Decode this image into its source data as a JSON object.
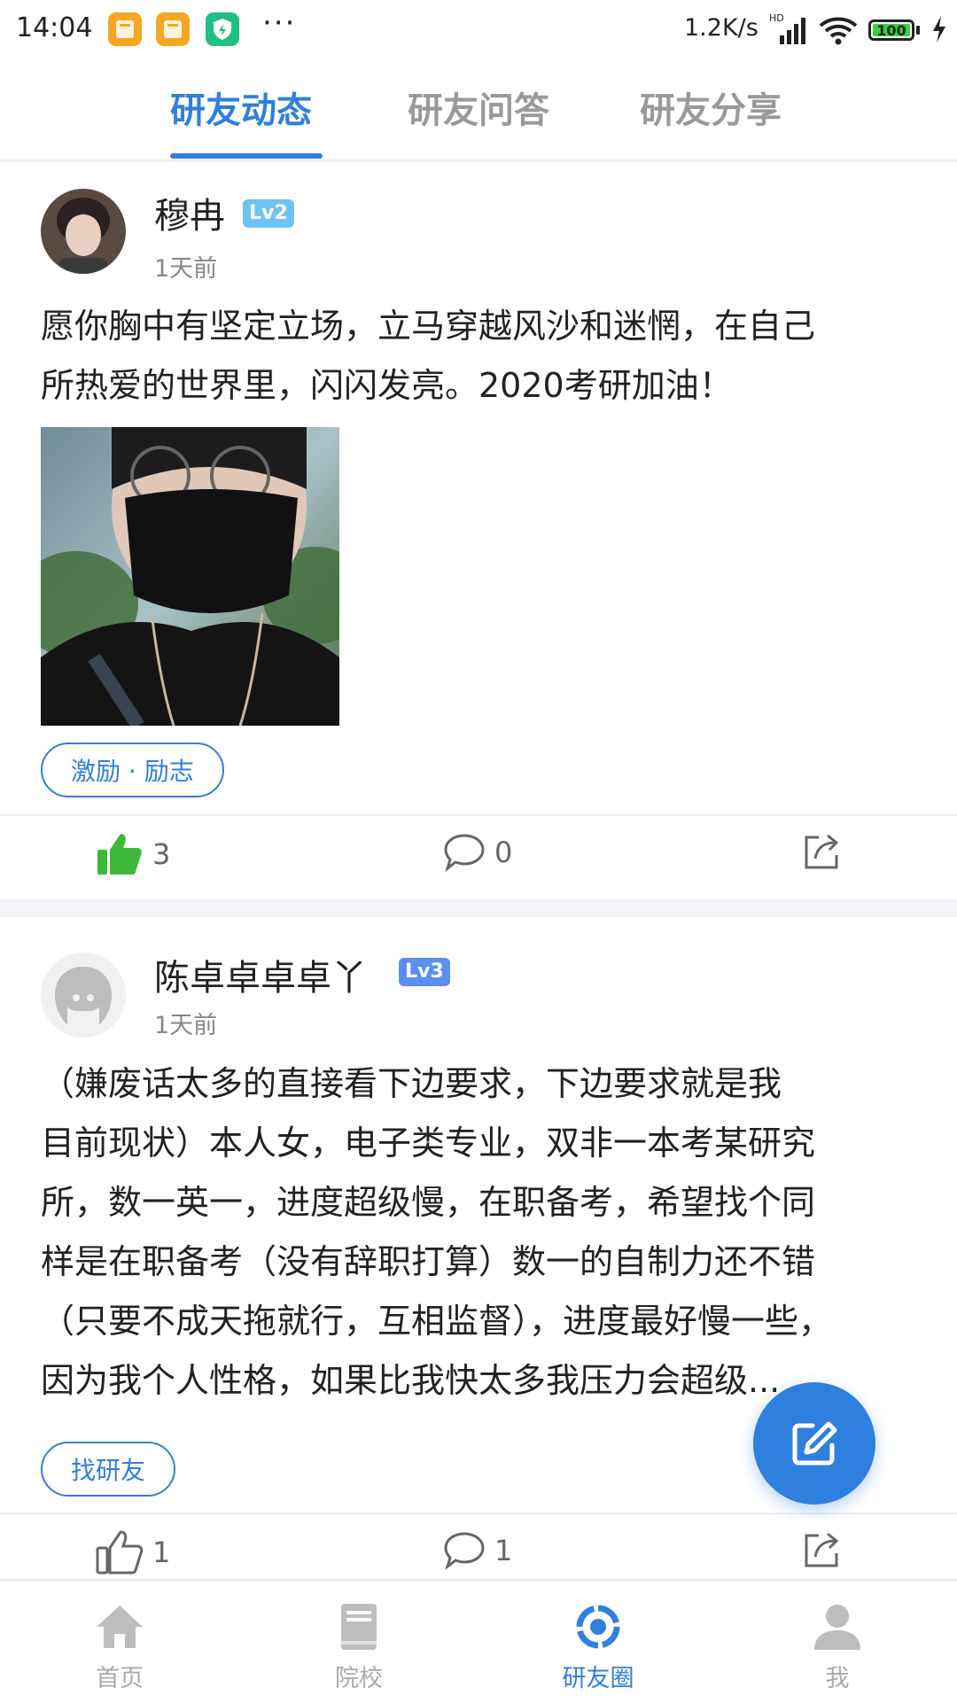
{
  "status_bar": {
    "time": "14:04",
    "network_speed": "1.2K/s",
    "network_type": "HD",
    "battery": "100",
    "notification_icons": [
      "orange-app-icon",
      "orange-app-icon",
      "green-shield-icon"
    ],
    "more": "···"
  },
  "tabs": [
    {
      "label": "研友动态",
      "active": true
    },
    {
      "label": "研友问答",
      "active": false
    },
    {
      "label": "研友分享",
      "active": false
    }
  ],
  "posts": [
    {
      "username": "穆冉",
      "level": "Lv2",
      "level_color": "#6ec3f2",
      "time": "1天前",
      "content_line1": "愿你胸中有坚定立场，立马穿越风沙和迷惘，在自己",
      "content_line2": "所热爱的世界里，闪闪发亮。2020考研加油！",
      "has_image": true,
      "tag": "激励 · 励志",
      "likes": "3",
      "liked": true,
      "comments": "0"
    },
    {
      "username": "陈卓卓卓卓丫",
      "level": "Lv3",
      "level_color": "#5b8ff0",
      "time": "1天前",
      "content_lines": [
        "（嫌废话太多的直接看下边要求，下边要求就是我",
        "目前现状）本人女，电子类专业，双非一本考某研究",
        "所，数一英一，进度超级慢，在职备考，希望找个同",
        "样是在职备考（没有辞职打算）数一的自制力还不错",
        "（只要不成天拖就行，互相监督），进度最好慢一些，",
        "因为我个人性格，如果比我快太多我压力会超级..."
      ],
      "tag": "找研友",
      "likes": "1",
      "liked": false,
      "comments": "1"
    }
  ],
  "bottom_nav": [
    {
      "label": "首页",
      "icon": "home-icon",
      "active": false
    },
    {
      "label": "院校",
      "icon": "book-icon",
      "active": false
    },
    {
      "label": "研友圈",
      "icon": "circle-icon",
      "active": true
    },
    {
      "label": "我",
      "icon": "person-icon",
      "active": false
    }
  ],
  "colors": {
    "accent": "#2f7fde",
    "like_active": "#3db83b",
    "muted_text": "#888888"
  }
}
